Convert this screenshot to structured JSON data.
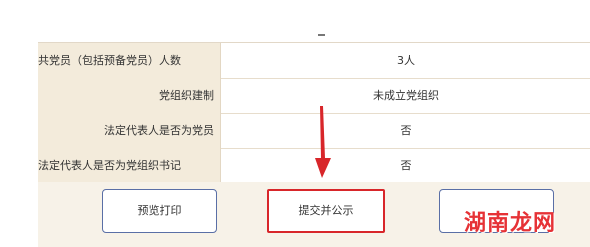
{
  "table": {
    "rows": [
      {
        "label": "共党员（包括预备党员）人数",
        "value": "3人"
      },
      {
        "label": "党组织建制",
        "value": "未成立党组织"
      },
      {
        "label": "法定代表人是否为党员",
        "value": "否"
      },
      {
        "label": "法定代表人是否为党组织书记",
        "value": "否"
      }
    ]
  },
  "buttons": {
    "preview_print": "预览打印",
    "submit_publish": "提交并公示",
    "third": ""
  },
  "watermark": "湖南龙网",
  "colors": {
    "label_bg": "#f3ebdb",
    "footer_bg": "#f7f2e8",
    "highlight_red": "#d8262a",
    "button_border": "#5a6fa6"
  },
  "icons": {
    "arrow": "red-down-arrow-annotation"
  }
}
